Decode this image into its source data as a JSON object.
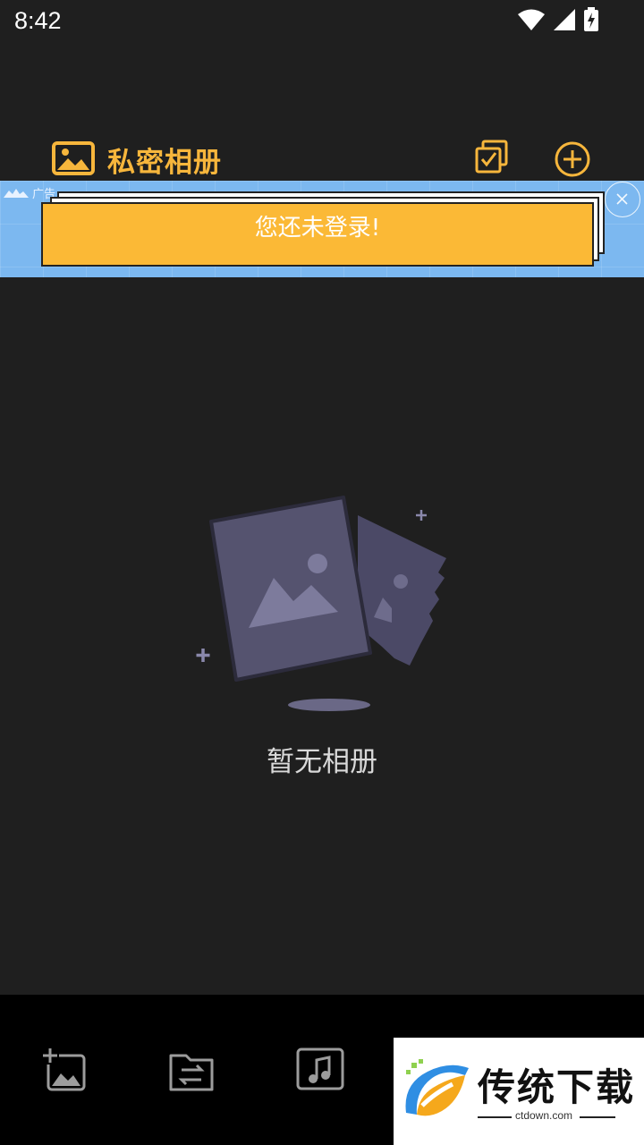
{
  "status_bar": {
    "time": "8:42"
  },
  "header": {
    "title": "私密相册",
    "accent_color": "#f7b63c"
  },
  "ad": {
    "tag": "广告",
    "message": "您还未登录!"
  },
  "empty_state": {
    "text": "暂无相册"
  },
  "bottom_nav": {
    "items": [
      {
        "icon": "add-photo-icon"
      },
      {
        "icon": "folder-transfer-icon"
      },
      {
        "icon": "music-icon"
      }
    ]
  },
  "watermark": {
    "title": "传统下载",
    "subtitle": "ctdown.com"
  },
  "colors": {
    "background": "#1f1f1f",
    "ad_background": "#7cb8f0",
    "ad_card": "#fbb936",
    "illustration": "#525070"
  }
}
